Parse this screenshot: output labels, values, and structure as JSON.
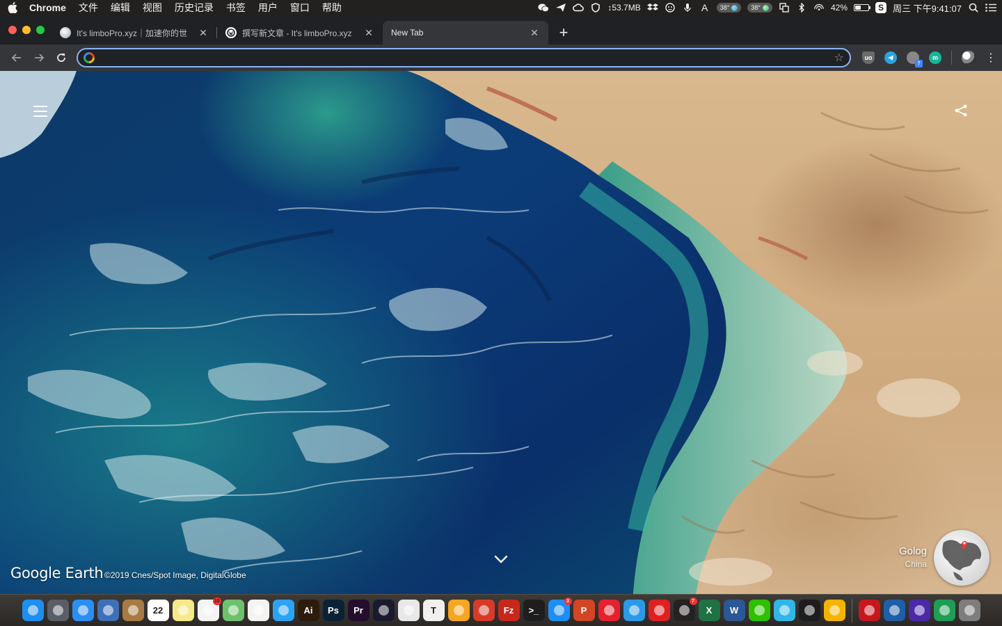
{
  "menubar": {
    "app_name": "Chrome",
    "menus": [
      "文件",
      "编辑",
      "视图",
      "历史记录",
      "书签",
      "用户",
      "窗口",
      "帮助"
    ],
    "status": {
      "memory": "↕53.7MB",
      "temp1": "38°",
      "temp2": "38°",
      "battery": "42%",
      "battery_level": 0.42,
      "clock": "周三 下午9:41:07"
    },
    "icons": [
      "wechat-icon",
      "send-icon",
      "creative-cloud-icon",
      "vpn-icon",
      "dropbox-icon",
      "face-icon",
      "microphone-icon",
      "input-a-icon",
      "bluetooth-icon",
      "airplay-icon",
      "spotlight-icon",
      "control-center-icon"
    ]
  },
  "tabs": [
    {
      "title": "It's limboPro.xyz｜加速你的世",
      "active": false,
      "favicon_color": "#cfd6e0"
    },
    {
      "title": "撰写新文章 - It's limboPro.xyz",
      "active": false,
      "favicon_color": "#ffffff"
    },
    {
      "title": "New Tab",
      "active": true,
      "favicon_color": ""
    }
  ],
  "toolbar": {
    "address_value": "",
    "extensions": [
      "ublock-icon",
      "telegram-icon",
      "extension-badge-icon",
      "mercury-icon"
    ]
  },
  "earth": {
    "logo": "Google Earth",
    "credit": "©2019 Cnes/Spot Image, DigitalGlobe",
    "location_name": "Golog",
    "location_country": "China"
  },
  "dock": {
    "apps": [
      {
        "name": "finder",
        "label": "",
        "color": "#1e8ef0"
      },
      {
        "name": "launchpad",
        "label": "",
        "color": "#5a5e66"
      },
      {
        "name": "safari",
        "label": "",
        "color": "#2a8ef2"
      },
      {
        "name": "preview",
        "label": "",
        "color": "#3d70b8"
      },
      {
        "name": "contacts",
        "label": "",
        "color": "#a87a42"
      },
      {
        "name": "calendar",
        "label": "22",
        "color": "#ffffff"
      },
      {
        "name": "notes",
        "label": "",
        "color": "#f5e98a"
      },
      {
        "name": "reminders",
        "label": "",
        "color": "#f4f4f4",
        "badge": "10"
      },
      {
        "name": "maps",
        "label": "",
        "color": "#6fc06d"
      },
      {
        "name": "photos",
        "label": "",
        "color": "#f3f3f3"
      },
      {
        "name": "messages",
        "label": "",
        "color": "#2ba3f5"
      },
      {
        "name": "illustrator",
        "label": "Ai",
        "color": "#2d1c0b"
      },
      {
        "name": "photoshop",
        "label": "Ps",
        "color": "#0b2235"
      },
      {
        "name": "premiere",
        "label": "Pr",
        "color": "#250d2e"
      },
      {
        "name": "siri",
        "label": "",
        "color": "#1a1a2e"
      },
      {
        "name": "chrome",
        "label": "",
        "color": "#e8e8e8"
      },
      {
        "name": "typora",
        "label": "T",
        "color": "#f0f0f0"
      },
      {
        "name": "pages",
        "label": "",
        "color": "#f5a623"
      },
      {
        "name": "parallels",
        "label": "",
        "color": "#d83a2a"
      },
      {
        "name": "filezilla",
        "label": "Fz",
        "color": "#c7281c"
      },
      {
        "name": "terminal",
        "label": ">_",
        "color": "#1e1e1e"
      },
      {
        "name": "app-store",
        "label": "",
        "color": "#1d8ef5",
        "badge": "3"
      },
      {
        "name": "powerpoint",
        "label": "P",
        "color": "#d24625"
      },
      {
        "name": "xmind",
        "label": "",
        "color": "#e3222f"
      },
      {
        "name": "netease-music",
        "label": "",
        "color": "#2b9ae6"
      },
      {
        "name": "zotero",
        "label": "",
        "color": "#e02020"
      },
      {
        "name": "qq",
        "label": "",
        "color": "#222222",
        "badge": "7"
      },
      {
        "name": "excel",
        "label": "X",
        "color": "#1f7244"
      },
      {
        "name": "word",
        "label": "W",
        "color": "#2b5797"
      },
      {
        "name": "wechat",
        "label": "",
        "color": "#2dc100"
      },
      {
        "name": "infuse",
        "label": "",
        "color": "#31b6e7"
      },
      {
        "name": "activity-monitor",
        "label": "",
        "color": "#1d1d1d"
      },
      {
        "name": "vpn-app",
        "label": "",
        "color": "#f5b400"
      }
    ],
    "right_apps": [
      {
        "name": "acrobat",
        "label": "",
        "color": "#c7171d"
      },
      {
        "name": "browser-alt",
        "label": "",
        "color": "#1f5fa8"
      },
      {
        "name": "mission-app",
        "label": "",
        "color": "#4a2aa8"
      },
      {
        "name": "google-earth",
        "label": "",
        "color": "#1f9d55"
      },
      {
        "name": "trash",
        "label": "",
        "color": "#7d7d7d"
      }
    ]
  }
}
